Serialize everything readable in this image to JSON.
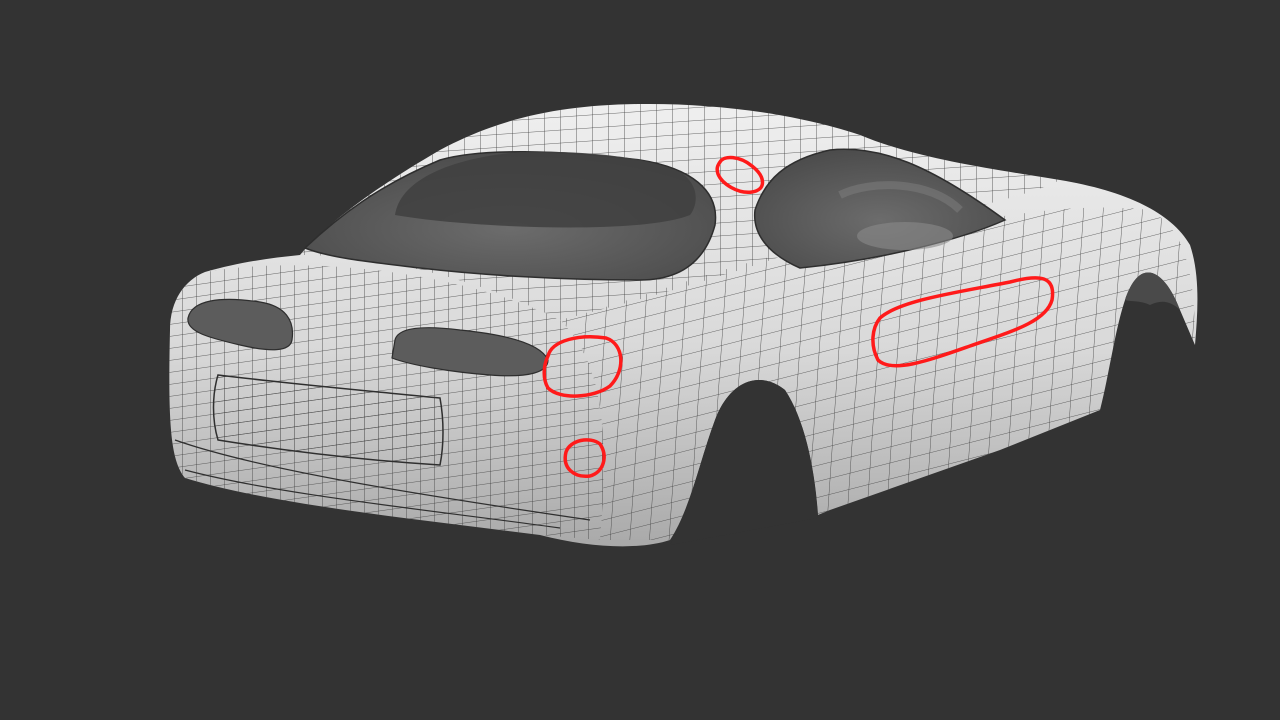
{
  "scene": {
    "background_color": "#333333",
    "subject": "car-body-wireframe-render",
    "body_color": "#dcdcdc",
    "wire_color": "#3a3a3a",
    "glass_color": "#5a5a5a",
    "annotation_color": "#ff1a1a",
    "annotation_count": 4
  }
}
